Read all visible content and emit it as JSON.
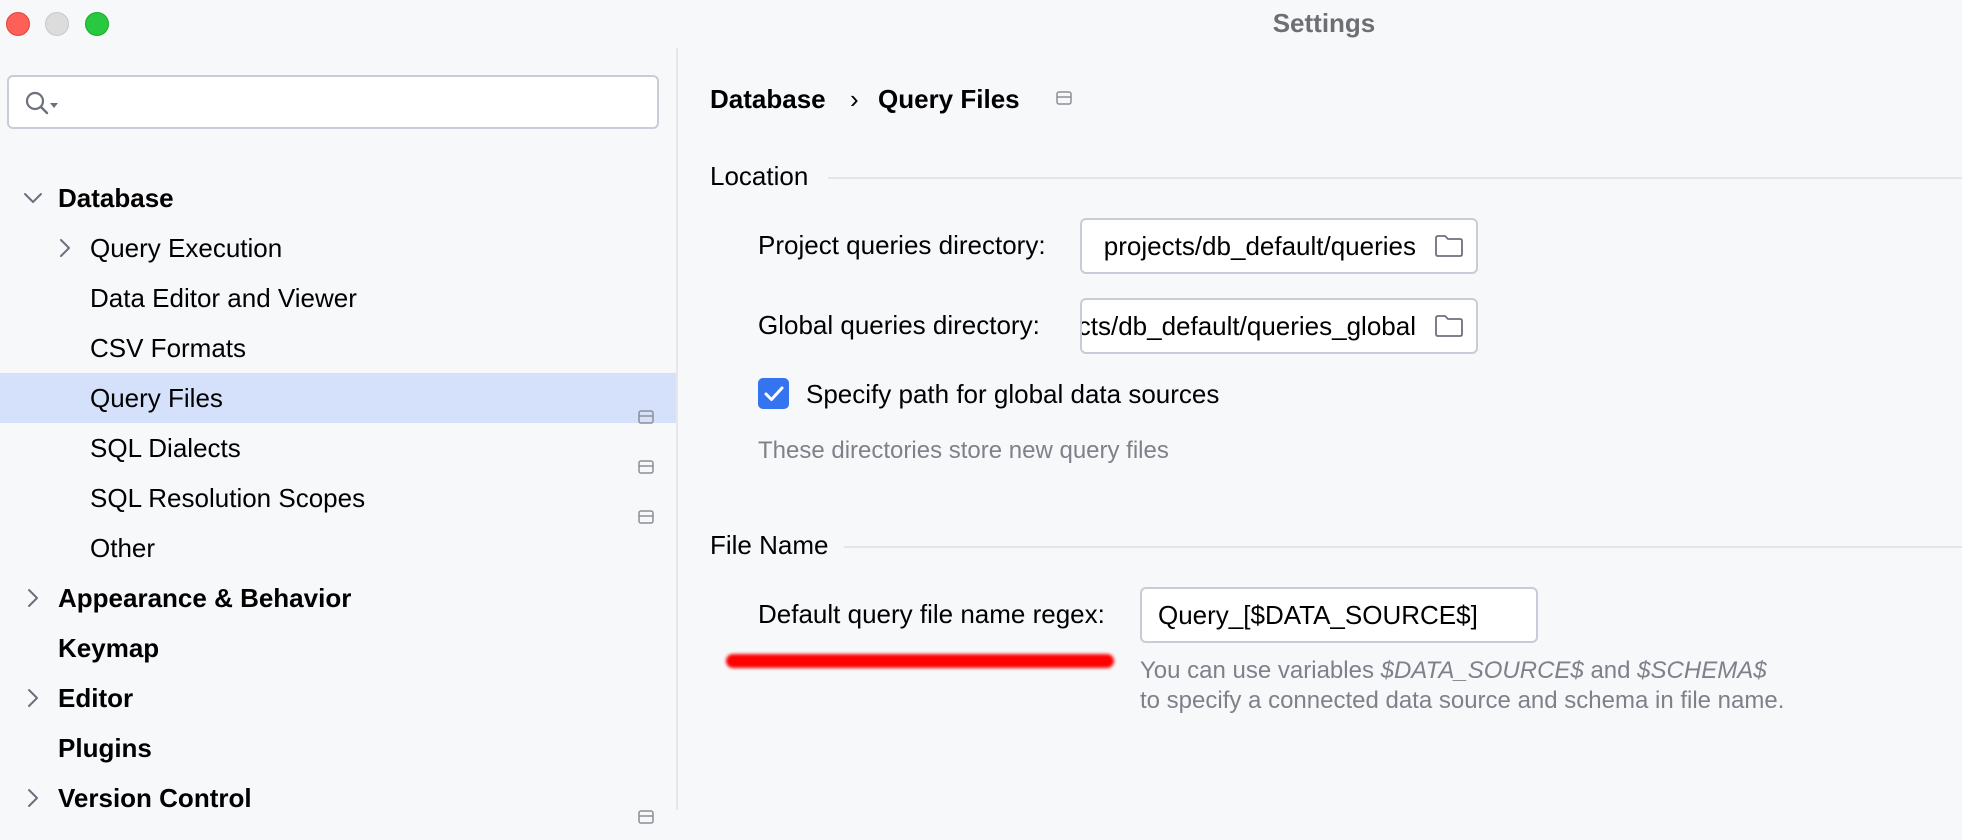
{
  "window": {
    "title": "Settings"
  },
  "search": {
    "placeholder": ""
  },
  "sidebar": {
    "items": [
      {
        "label": "Database",
        "level": 0,
        "bold": true,
        "expandable": true,
        "expanded": true,
        "selected": false,
        "pinned": false
      },
      {
        "label": "Query Execution",
        "level": 1,
        "bold": false,
        "expandable": true,
        "expanded": false,
        "selected": false,
        "pinned": false
      },
      {
        "label": "Data Editor and Viewer",
        "level": 1,
        "bold": false,
        "expandable": false,
        "selected": false,
        "pinned": false
      },
      {
        "label": "CSV Formats",
        "level": 1,
        "bold": false,
        "expandable": false,
        "selected": false,
        "pinned": false
      },
      {
        "label": "Query Files",
        "level": 1,
        "bold": false,
        "expandable": false,
        "selected": true,
        "pinned": true
      },
      {
        "label": "SQL Dialects",
        "level": 1,
        "bold": false,
        "expandable": false,
        "selected": false,
        "pinned": true
      },
      {
        "label": "SQL Resolution Scopes",
        "level": 1,
        "bold": false,
        "expandable": false,
        "selected": false,
        "pinned": true
      },
      {
        "label": "Other",
        "level": 1,
        "bold": false,
        "expandable": false,
        "selected": false,
        "pinned": false
      },
      {
        "label": "Appearance & Behavior",
        "level": 0,
        "bold": true,
        "expandable": true,
        "expanded": false,
        "selected": false,
        "pinned": false
      },
      {
        "label": "Keymap",
        "level": 0,
        "bold": true,
        "expandable": false,
        "selected": false,
        "pinned": false
      },
      {
        "label": "Editor",
        "level": 0,
        "bold": true,
        "expandable": true,
        "expanded": false,
        "selected": false,
        "pinned": false
      },
      {
        "label": "Plugins",
        "level": 0,
        "bold": true,
        "expandable": false,
        "selected": false,
        "pinned": false
      },
      {
        "label": "Version Control",
        "level": 0,
        "bold": true,
        "expandable": true,
        "expanded": false,
        "selected": false,
        "pinned": true
      }
    ]
  },
  "breadcrumb": {
    "parent": "Database",
    "separator": "›",
    "current": "Query Files"
  },
  "location": {
    "title": "Location",
    "project_label": "Project queries directory:",
    "project_value": "projects/db_default/queries",
    "global_label": "Global queries directory:",
    "global_value": "projects/db_default/queries_global",
    "checkbox_label": "Specify path for global data sources",
    "checkbox_checked": true,
    "hint": "These directories store new query files"
  },
  "file_name": {
    "title": "File Name",
    "regex_label": "Default query file name regex:",
    "regex_value": "Query_[$DATA_SOURCE$]",
    "hint_prefix": "You can use variables ",
    "hint_var1": "$DATA_SOURCE$",
    "hint_and": " and ",
    "hint_var2": "$SCHEMA$",
    "hint_line2": "to specify a connected data source and schema in file name."
  },
  "colors": {
    "accent": "#3574f0",
    "selection": "#d5e1fb",
    "annotation": "#ff0000"
  }
}
